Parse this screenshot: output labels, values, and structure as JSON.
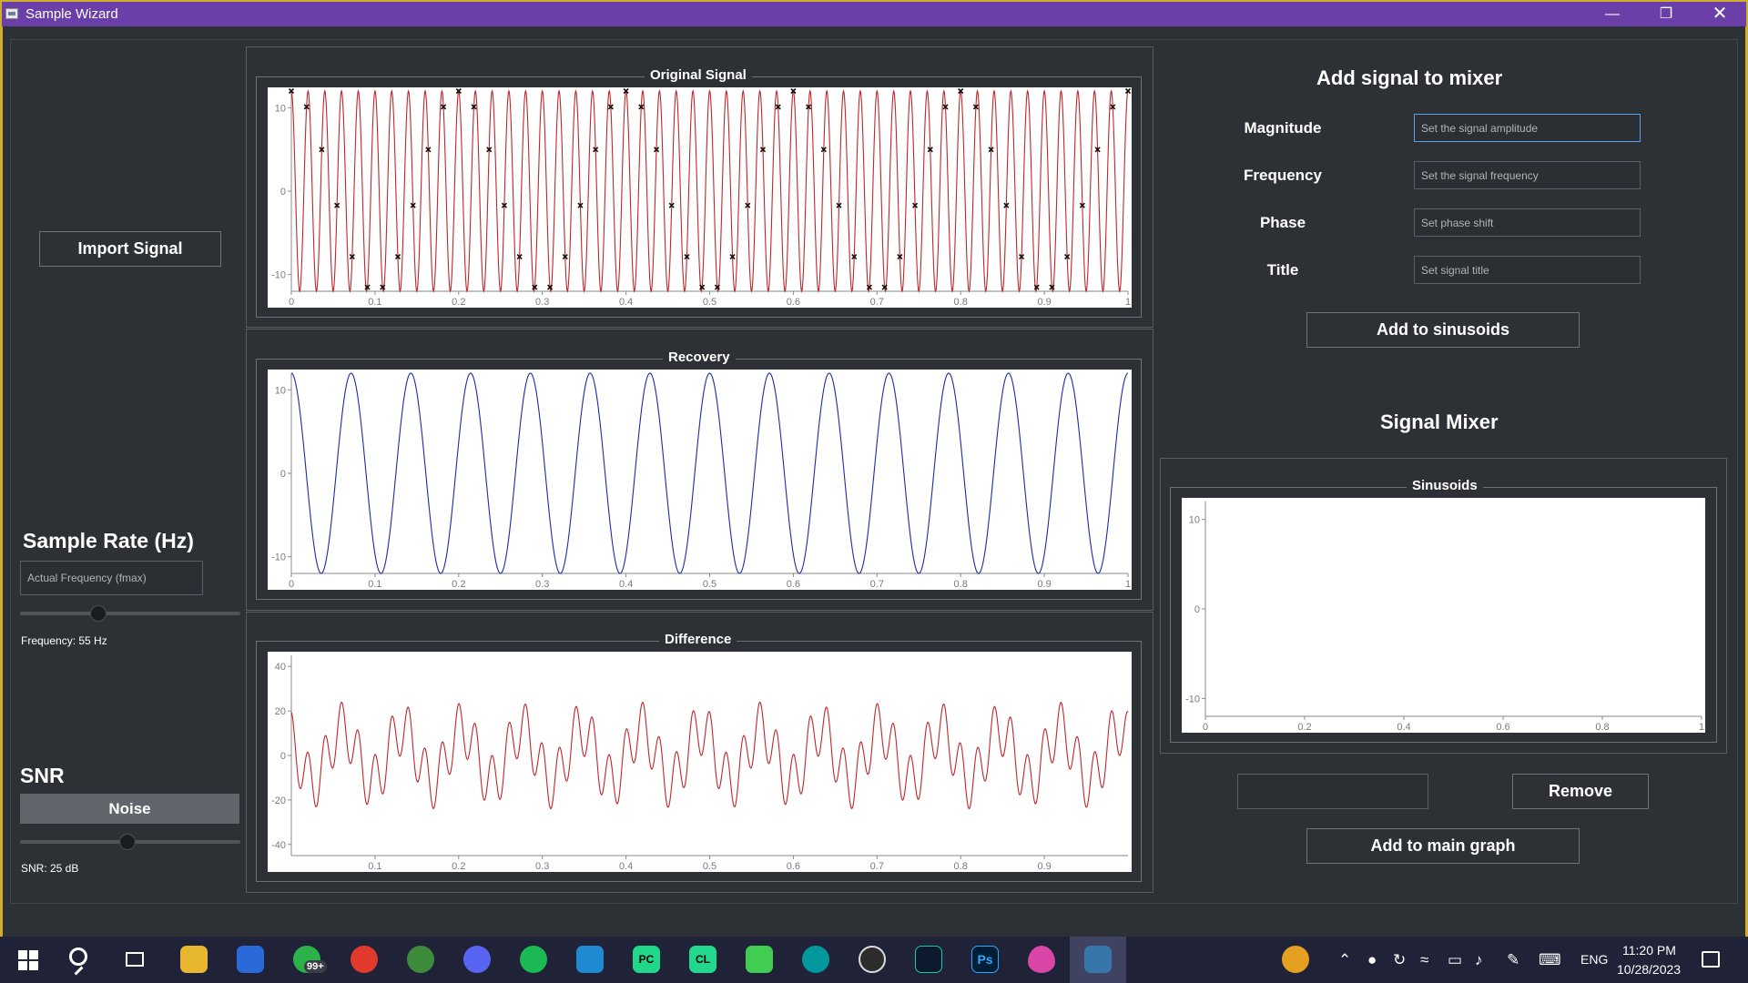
{
  "window": {
    "title": "Sample Wizard"
  },
  "left_panel": {
    "import_label": "Import Signal",
    "sample_rate_heading": "Sample Rate (Hz)",
    "fmax_placeholder": "Actual Frequency (fmax)",
    "frequency_text": "Frequency: 55 Hz",
    "snr_heading": "SNR",
    "noise_label": "Noise",
    "snr_text": "SNR: 25 dB"
  },
  "plots": {
    "original": {
      "title": "Original Signal",
      "yticks": [
        "10",
        "0",
        "-10"
      ],
      "xticks": [
        "0",
        "0.1",
        "0.2",
        "0.3",
        "0.4",
        "0.5",
        "0.6",
        "0.7",
        "0.8",
        "0.9",
        "1"
      ]
    },
    "recovery": {
      "title": "Recovery",
      "yticks": [
        "10",
        "0",
        "-10"
      ],
      "xticks": [
        "0",
        "0.1",
        "0.2",
        "0.3",
        "0.4",
        "0.5",
        "0.6",
        "0.7",
        "0.8",
        "0.9",
        "1"
      ]
    },
    "difference": {
      "title": "Difference",
      "yticks": [
        "40",
        "20",
        "0",
        "-20",
        "-40"
      ],
      "xticks": [
        "0.1",
        "0.2",
        "0.3",
        "0.4",
        "0.5",
        "0.6",
        "0.7",
        "0.8",
        "0.9"
      ]
    },
    "sinusoids": {
      "title": "Sinusoids",
      "yticks": [
        "10",
        "0",
        "-10"
      ],
      "xticks": [
        "0",
        "0.2",
        "0.4",
        "0.6",
        "0.8",
        "1"
      ]
    }
  },
  "chart_data": [
    {
      "type": "line",
      "title": "Original Signal",
      "xlim": [
        0,
        1
      ],
      "ylim": [
        -12,
        12
      ],
      "line_color": "#c0262a",
      "marker": "x",
      "signal": {
        "amplitude": 12,
        "frequency_hz": 50
      },
      "sample_rate_hz": 55,
      "grid": false
    },
    {
      "type": "line",
      "title": "Recovery",
      "xlim": [
        0,
        1
      ],
      "ylim": [
        -12,
        12
      ],
      "line_color": "#1c2aa8",
      "signal": {
        "amplitude": 12,
        "frequency_hz": 14
      },
      "grid": false
    },
    {
      "type": "line",
      "title": "Difference",
      "xlim": [
        0,
        1
      ],
      "ylim": [
        -45,
        45
      ],
      "line_color": "#c0262a",
      "signal": {
        "components": [
          {
            "amplitude": 12,
            "frequency_hz": 50
          },
          {
            "amplitude": 12,
            "frequency_hz": 14
          }
        ]
      },
      "grid": false
    },
    {
      "type": "line",
      "title": "Sinusoids",
      "xlim": [
        0,
        1
      ],
      "ylim": [
        -12,
        12
      ],
      "series": [],
      "grid": false
    }
  ],
  "mixer": {
    "heading": "Add signal to mixer",
    "magnitude_label": "Magnitude",
    "magnitude_placeholder": "Set the signal amplitude",
    "frequency_label": "Frequency",
    "frequency_placeholder": "Set the signal frequency",
    "phase_label": "Phase",
    "phase_placeholder": "Set phase shift",
    "title_label": "Title",
    "title_placeholder": "Set signal title",
    "add_sinusoids_label": "Add to sinusoids",
    "signal_mixer_heading": "Signal Mixer",
    "remove_label": "Remove",
    "add_main_label": "Add to main graph"
  },
  "taskbar": {
    "whatsapp_badge": "99+",
    "pycharm_abbr": "PC",
    "clion_abbr": "CL",
    "photoshop_abbr": "Ps",
    "language": "ENG",
    "time": "11:20 PM",
    "date": "10/28/2023"
  }
}
